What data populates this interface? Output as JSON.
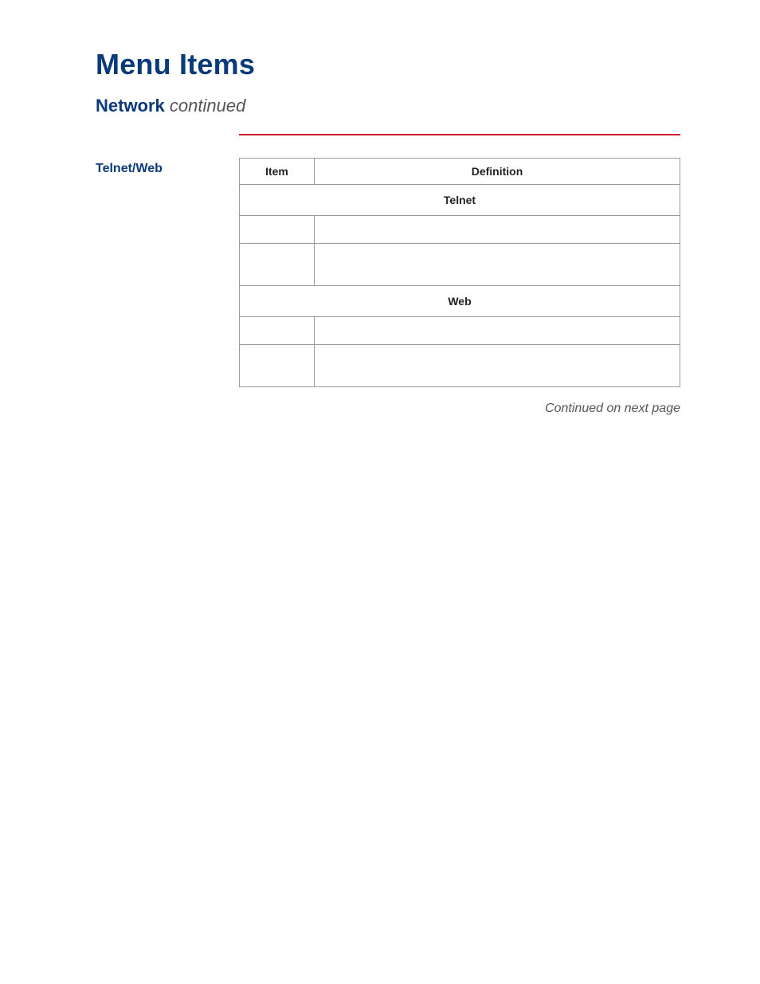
{
  "header": {
    "page_title": "Menu Items",
    "section_name": "Network",
    "section_continued_label": "continued"
  },
  "subsection": {
    "title": "Telnet/Web"
  },
  "table": {
    "columns": {
      "item": "Item",
      "definition": "Definition"
    },
    "groups": [
      {
        "label": "Telnet",
        "rows": [
          {
            "item": "",
            "definition": "",
            "size": "small"
          },
          {
            "item": "",
            "definition": "",
            "size": "big"
          }
        ]
      },
      {
        "label": "Web",
        "rows": [
          {
            "item": "",
            "definition": "",
            "size": "small"
          },
          {
            "item": "",
            "definition": "",
            "size": "big"
          }
        ]
      }
    ]
  },
  "footer": {
    "continued_note": "Continued on next page"
  }
}
